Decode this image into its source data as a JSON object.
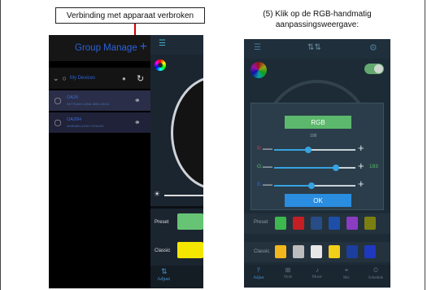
{
  "callout": {
    "text": "Verbinding met apparaat verbroken",
    "arrow_color": "#d40000"
  },
  "caption": {
    "line1": "(5) Klik op de RGB-handmatig",
    "line2": "aanpassingsweergave:"
  },
  "left_screen": {
    "header_title": "Group Manage",
    "header_plus": "+",
    "group_label": "My Devices",
    "devices": [
      {
        "name": "OA20",
        "id": "3877B4AH-44N6-3856-20OA"
      },
      {
        "name": "OA20H",
        "id": "4A4B4B4-444H-7G08-8G"
      }
    ],
    "preset_label": "Preset",
    "classic_label": "Classic",
    "nav_label": "Adjust",
    "icons": [
      "chevron-down-icon",
      "group-icon",
      "refresh-icon",
      "bulb-icon",
      "link-broken-icon",
      "link-icon",
      "menu-icon",
      "color-wheel-icon",
      "sun-icon",
      "adjust-icon"
    ]
  },
  "rgb_dialog": {
    "title": "RGB",
    "top_value": "108",
    "channels": [
      {
        "label": "R:",
        "value": "",
        "color": "#d6304a",
        "percent": 42
      },
      {
        "label": "G:",
        "value": "193",
        "color": "#52c066",
        "percent": 76
      },
      {
        "label": "B:",
        "value": "",
        "color": "#2a62d9",
        "percent": 46
      }
    ],
    "ok_label": "OK",
    "plus": "+",
    "minus": "—"
  },
  "right_screen": {
    "preset_label": "Preset",
    "classic_label": "Classic",
    "preset_swatches": [
      "#3cb84f",
      "#c51f24",
      "#274c86",
      "#1d4fa8",
      "#8a3cc2",
      "#7b7f12"
    ],
    "classic_swatches": [
      "#f2b71c",
      "#bdbdbd",
      "#e7e7e7",
      "#f2cf18",
      "#1c3e9e",
      "#1e39c0"
    ],
    "nav": [
      {
        "icon": "⫯",
        "label": "Adjust"
      },
      {
        "icon": "⊞",
        "label": "Style"
      },
      {
        "icon": "♪",
        "label": "Music"
      },
      {
        "icon": "⌖",
        "label": "Mic"
      },
      {
        "icon": "⏲",
        "label": "Schedule"
      }
    ]
  }
}
